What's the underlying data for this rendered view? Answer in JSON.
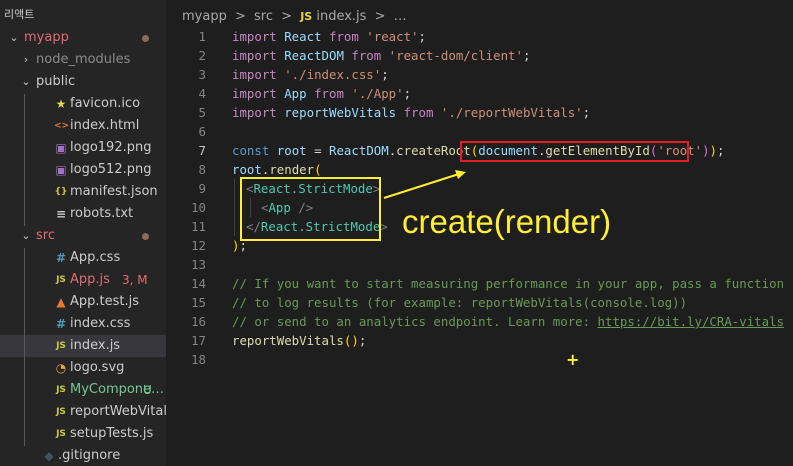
{
  "sidebar": {
    "title": "리액트",
    "items": [
      {
        "chevron": "⌄",
        "name": "myapp",
        "color": "#e06c75",
        "badge": "",
        "dot": true,
        "indent": 0,
        "selected": false
      },
      {
        "chevron": "›",
        "name": "node_modules",
        "color": "#8b8b8b",
        "badge": "",
        "indent": 1
      },
      {
        "chevron": "⌄",
        "name": "public",
        "color": "#cccccc",
        "badge": "",
        "indent": 1
      },
      {
        "icon": "★",
        "icon_name": "star-icon",
        "icon_color": "#e8d44d",
        "name": "favicon.ico",
        "color": "#cccccc",
        "indent": 2
      },
      {
        "icon": "<>",
        "icon_name": "html-icon",
        "icon_color": "#e37933",
        "name": "index.html",
        "color": "#cccccc",
        "indent": 2
      },
      {
        "icon": "▣",
        "icon_name": "image-icon",
        "icon_color": "#a074c4",
        "name": "logo192.png",
        "color": "#cccccc",
        "indent": 2
      },
      {
        "icon": "▣",
        "icon_name": "image-icon",
        "icon_color": "#a074c4",
        "name": "logo512.png",
        "color": "#cccccc",
        "indent": 2
      },
      {
        "icon": "{}",
        "icon_name": "json-icon",
        "icon_color": "#cbcb41",
        "name": "manifest.json",
        "color": "#cccccc",
        "indent": 2
      },
      {
        "icon": "≡",
        "icon_name": "text-file-icon",
        "icon_color": "#cccccc",
        "name": "robots.txt",
        "color": "#cccccc",
        "indent": 2
      },
      {
        "chevron": "⌄",
        "name": "src",
        "color": "#e06c75",
        "badge": "",
        "dot": true,
        "indent": 1
      },
      {
        "icon": "#",
        "icon_name": "css-icon",
        "icon_color": "#519aba",
        "name": "App.css",
        "color": "#cccccc",
        "indent": 2
      },
      {
        "icon": "JS",
        "icon_name": "javascript-icon",
        "icon_color": "#cbcb41",
        "name": "App.js",
        "color": "#e06c75",
        "badge": "3, M",
        "badge_color": "#e06c75",
        "indent": 2
      },
      {
        "icon": "▲",
        "icon_name": "test-icon",
        "icon_color": "#e37933",
        "name": "App.test.js",
        "color": "#cccccc",
        "indent": 2
      },
      {
        "icon": "#",
        "icon_name": "css-icon",
        "icon_color": "#519aba",
        "name": "index.css",
        "color": "#cccccc",
        "indent": 2
      },
      {
        "icon": "JS",
        "icon_name": "javascript-icon",
        "icon_color": "#cbcb41",
        "name": "index.js",
        "color": "#cccccc",
        "indent": 2,
        "selected": true
      },
      {
        "icon": "◔",
        "icon_name": "svg-icon",
        "icon_color": "#e8a33d",
        "name": "logo.svg",
        "color": "#cccccc",
        "indent": 2
      },
      {
        "icon": "JS",
        "icon_name": "javascript-icon",
        "icon_color": "#cbcb41",
        "name": "MyCompone…",
        "color": "#73c991",
        "badge": "U",
        "badge_color": "#73c991",
        "indent": 2
      },
      {
        "icon": "JS",
        "icon_name": "javascript-icon",
        "icon_color": "#cbcb41",
        "name": "reportWebVitals.js",
        "color": "#cccccc",
        "indent": 2
      },
      {
        "icon": "JS",
        "icon_name": "javascript-icon",
        "icon_color": "#cbcb41",
        "name": "setupTests.js",
        "color": "#cccccc",
        "indent": 2
      },
      {
        "icon": "◆",
        "icon_name": "git-icon",
        "icon_color": "#41535b",
        "name": ".gitignore",
        "color": "#cccccc",
        "indent": 1
      }
    ]
  },
  "breadcrumb": {
    "part1": "myapp",
    "sep": ">",
    "part2": "src",
    "js_icon": "JS",
    "part3": "index.js",
    "ellipsis": "…"
  },
  "code": {
    "line_numbers": [
      "1",
      "2",
      "3",
      "4",
      "5",
      "6",
      "7",
      "8",
      "9",
      "10",
      "11",
      "12",
      "13",
      "14",
      "15",
      "16",
      "17",
      "18"
    ],
    "l1": {
      "kw": "import",
      "a": " React ",
      "from": "from",
      "s": " 'react'",
      "end": ";"
    },
    "l2": {
      "kw": "import",
      "a": " ReactDOM ",
      "from": "from",
      "s": " 'react-dom/client'",
      "end": ";"
    },
    "l3": {
      "kw": "import",
      "s": " './index.css'",
      "end": ";"
    },
    "l4": {
      "kw": "import",
      "a": " App ",
      "from": "from",
      "s": " './App'",
      "end": ";"
    },
    "l5": {
      "kw": "import",
      "a": " reportWebVitals ",
      "from": "from",
      "s": " './reportWebVitals'",
      "end": ";"
    },
    "l7": {
      "kw": "const",
      "v": " root",
      "eq": " = ",
      "obj": "ReactDOM",
      "dot": ".",
      "fn": "createRoot",
      "p1": "(",
      "doc": "document",
      "dot2": ".",
      "fn2": "getElementById",
      "p2": "(",
      "s": "'root'",
      "p3": ")",
      "p4": ")",
      "end": ";"
    },
    "l8": {
      "v": "root",
      "dot": ".",
      "fn": "render",
      "p": "("
    },
    "l9": {
      "lt": "<",
      "tag": "React.StrictMode",
      "gt": ">"
    },
    "l10": {
      "lt": "<",
      "tag": "App",
      "sl": " />"
    },
    "l11": {
      "lt": "</",
      "tag": "React.StrictMode",
      "gt": ">"
    },
    "l12": {
      "p": ")",
      "end": ";"
    },
    "l14": "// If you want to start measuring performance in your app, pass a function",
    "l15": "// to log results (for example: reportWebVitals(console.log))",
    "l16a": "// or send to an analytics endpoint. Learn more: ",
    "l16b": "https://bit.ly/CRA-vitals",
    "l17": {
      "fn": "reportWebVitals",
      "p": "()",
      "end": ";"
    }
  },
  "annotation": {
    "text": "create(render)",
    "color": "#ffee33",
    "box_color_red": "#e51c23",
    "box_color_yellow": "#ffee33"
  },
  "colors": {
    "sidebar_bg": "#252526",
    "editor_bg": "#1e1e1e",
    "selected_row": "#37373d"
  }
}
